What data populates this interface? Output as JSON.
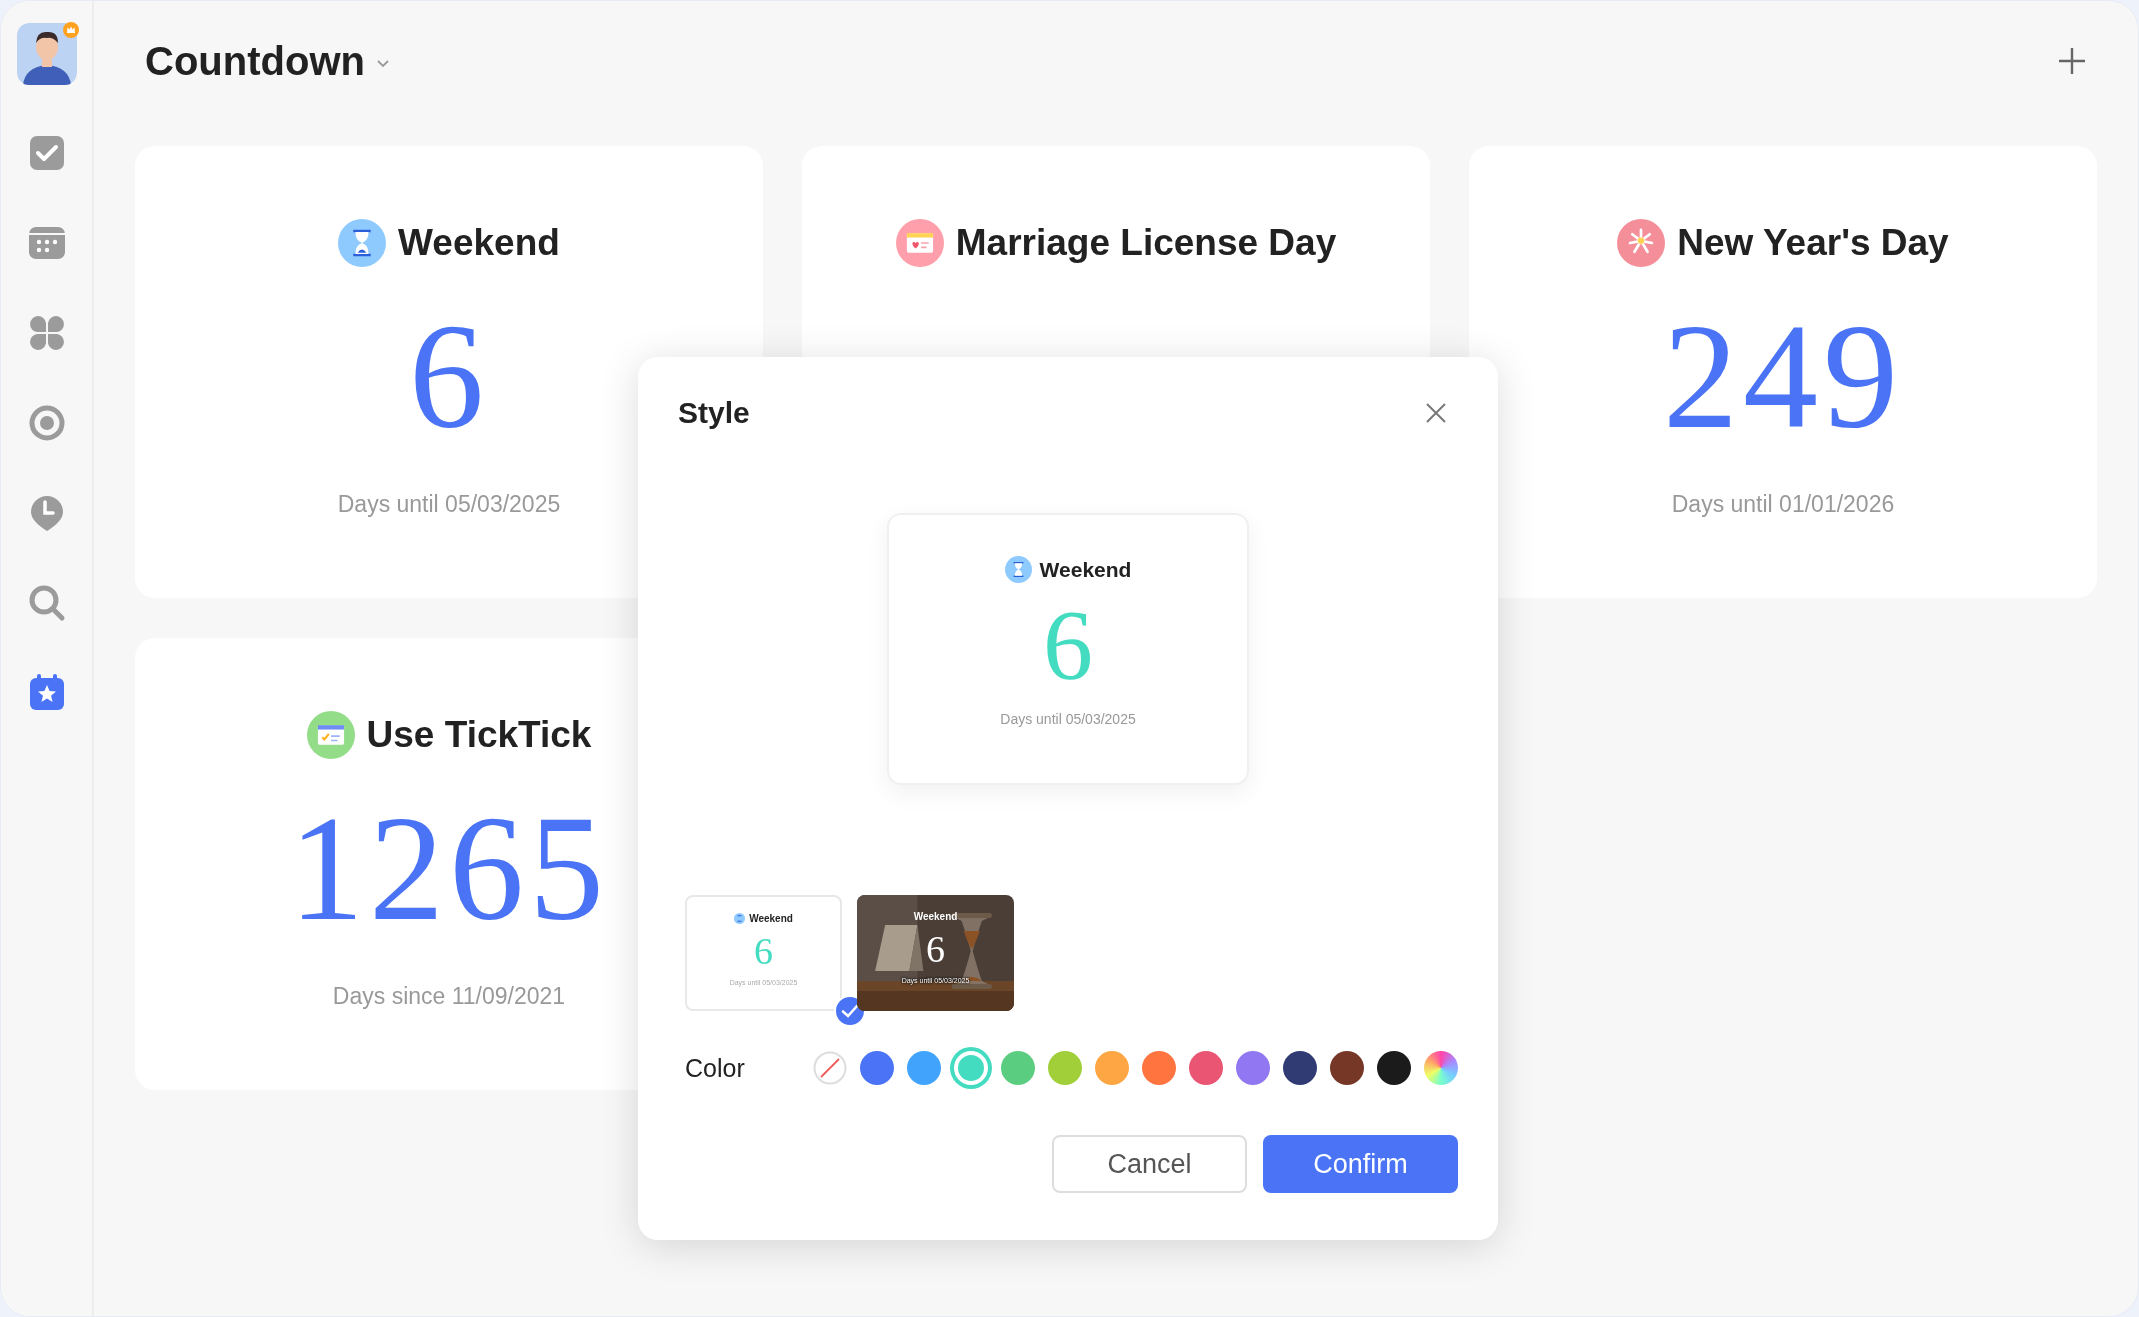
{
  "sidebar": {
    "avatar": {
      "premium": true
    },
    "items": [
      {
        "kind": "tasks",
        "selected": false
      },
      {
        "kind": "calendar",
        "selected": false
      },
      {
        "kind": "matrix",
        "selected": false
      },
      {
        "kind": "focus",
        "selected": false
      },
      {
        "kind": "habit",
        "selected": false
      },
      {
        "kind": "search",
        "selected": false
      },
      {
        "kind": "countdown",
        "selected": true
      }
    ]
  },
  "header": {
    "title": "Countdown"
  },
  "cards": [
    {
      "kind": "hourglass",
      "title": "Weekend",
      "count": "6",
      "subtitle": "Days until 05/03/2025"
    },
    {
      "kind": "certificate",
      "title": "Marriage License Day"
    },
    {
      "kind": "firework",
      "title": "New Year's Day",
      "count": "249",
      "subtitle": "Days until 01/01/2026"
    },
    {
      "kind": "app",
      "title": "Use TickTick",
      "count": "1265",
      "subtitle": "Days since 11/09/2021"
    }
  ],
  "dialog": {
    "title": "Style",
    "preview": {
      "kind": "hourglass",
      "title": "Weekend",
      "count": "6",
      "subtitle": "Days until 05/03/2025"
    },
    "styles": [
      {
        "kind": "plain",
        "selected": true,
        "title": "Weekend",
        "count": "6",
        "subtitle": "Days until 05/03/2025"
      },
      {
        "selected": false,
        "title": "Weekend",
        "count": "6",
        "subtitle": "Days until 05/03/2025"
      }
    ],
    "color_label": "Color",
    "colors": [
      {
        "kind": "none",
        "selected": false
      },
      {
        "kind": "solid",
        "color": "#4a74f5",
        "selected": false
      },
      {
        "kind": "solid",
        "color": "#41a3fb",
        "selected": false
      },
      {
        "kind": "solid",
        "color": "#44dcc0",
        "selected": true
      },
      {
        "kind": "solid",
        "color": "#5bcd80",
        "selected": false
      },
      {
        "kind": "solid",
        "color": "#a1cf3a",
        "selected": false
      },
      {
        "kind": "solid",
        "color": "#ffa644",
        "selected": false
      },
      {
        "kind": "solid",
        "color": "#ff743f",
        "selected": false
      },
      {
        "kind": "solid",
        "color": "#e95572",
        "selected": false
      },
      {
        "kind": "solid",
        "color": "#9277f2",
        "selected": false
      },
      {
        "kind": "solid",
        "color": "#2f3b72",
        "selected": false
      },
      {
        "kind": "solid",
        "color": "#763727",
        "selected": false
      },
      {
        "kind": "solid",
        "color": "#1b1b1b",
        "selected": false
      },
      {
        "kind": "gradient",
        "selected": false
      }
    ],
    "buttons": [
      {
        "kind": "secondary",
        "label": "Cancel"
      },
      {
        "kind": "primary",
        "label": "Confirm"
      }
    ]
  }
}
